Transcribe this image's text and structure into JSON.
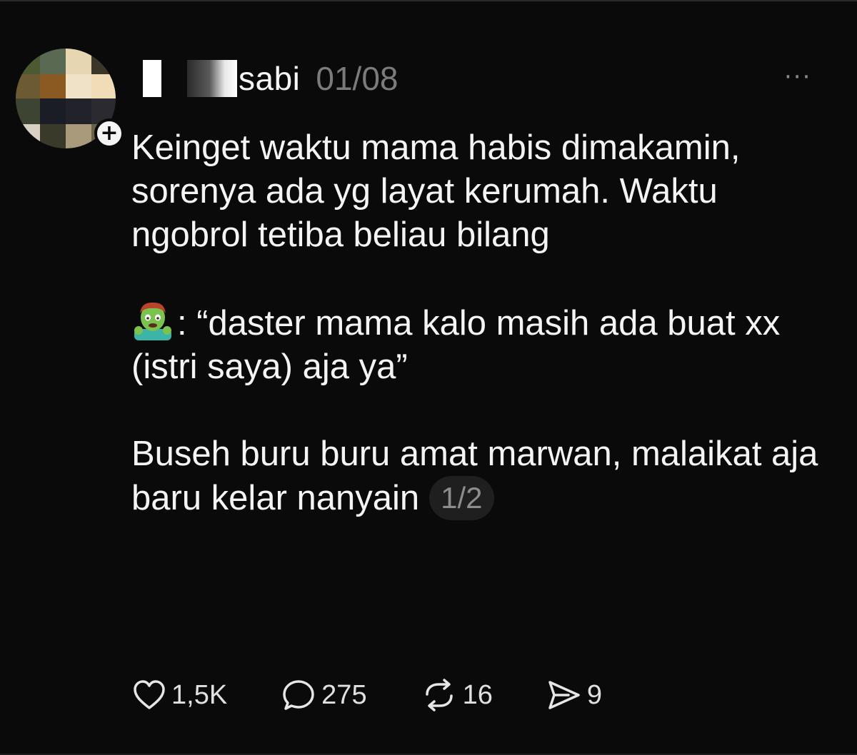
{
  "post": {
    "username": "sabi",
    "date": "01/08",
    "paragraphs": [
      "Keinget waktu mama habis dimakamin, sorenya ada yg layat kerumah. Waktu ngobrol tetiba beliau bilang",
      ": “daster mama kalo masih ada buat xx (istri saya) aja ya”",
      "Buseh buru buru amat marwan, malaikat aja baru kelar nanyain"
    ],
    "page_indicator": "1/2"
  },
  "more_menu": "···",
  "actions": {
    "like_count": "1,5K",
    "reply_count": "275",
    "repost_count": "16",
    "share_count": "9"
  },
  "icons": {
    "like": "heart-icon",
    "reply": "comment-bubble-icon",
    "repost": "repost-icon",
    "share": "send-icon",
    "follow": "plus-icon",
    "emoji": "zombie-emoji"
  },
  "colors": {
    "background": "#0a0a0a",
    "text": "#f4f4f4",
    "muted": "#7b7b7b",
    "badge_bg": "#1f1f1f"
  }
}
